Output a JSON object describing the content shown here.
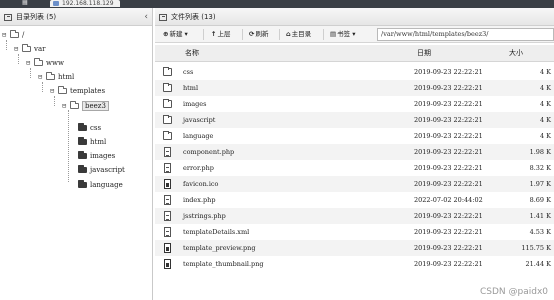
{
  "window": {
    "host": "192.168.118.129"
  },
  "left_panel": {
    "title": "目录列表",
    "count": "(5)",
    "collapse_glyph": "‹",
    "tree": [
      {
        "label": "/",
        "toggle": "⊟"
      },
      {
        "label": "var",
        "toggle": "⊟"
      },
      {
        "label": "www",
        "toggle": "⊟"
      },
      {
        "label": "html",
        "toggle": "⊟"
      },
      {
        "label": "templates",
        "toggle": "⊟"
      },
      {
        "label": "beez3",
        "toggle": "⊟"
      },
      {
        "label": "css",
        "toggle": ""
      },
      {
        "label": "html",
        "toggle": ""
      },
      {
        "label": "images",
        "toggle": ""
      },
      {
        "label": "javascript",
        "toggle": ""
      },
      {
        "label": "language",
        "toggle": ""
      }
    ]
  },
  "right_panel": {
    "title": "文件列表",
    "count": "(13)",
    "toolbar": {
      "new_label": "新建",
      "up_label": "上层",
      "refresh_label": "刷新",
      "home_label": "主目录",
      "bookmark_label": "书签",
      "path_value": "/var/www/html/templates/beez3/"
    },
    "columns": {
      "name": "名称",
      "date": "日期",
      "size": "大小"
    },
    "files": [
      {
        "name": "css",
        "date": "2019-09-23 22:22:21",
        "size": "4 K",
        "kind": "folder"
      },
      {
        "name": "html",
        "date": "2019-09-23 22:22:21",
        "size": "4 K",
        "kind": "folder"
      },
      {
        "name": "images",
        "date": "2019-09-23 22:22:21",
        "size": "4 K",
        "kind": "folder"
      },
      {
        "name": "javascript",
        "date": "2019-09-23 22:22:21",
        "size": "4 K",
        "kind": "folder"
      },
      {
        "name": "language",
        "date": "2019-09-23 22:22:21",
        "size": "4 K",
        "kind": "folder"
      },
      {
        "name": "component.php",
        "date": "2019-09-23 22:22:21",
        "size": "1.98 K",
        "kind": "file"
      },
      {
        "name": "error.php",
        "date": "2019-09-23 22:22:21",
        "size": "8.32 K",
        "kind": "file"
      },
      {
        "name": "favicon.ico",
        "date": "2019-09-23 22:22:21",
        "size": "1.97 K",
        "kind": "image"
      },
      {
        "name": "index.php",
        "date": "2022-07-02 20:44:02",
        "size": "8.69 K",
        "kind": "file"
      },
      {
        "name": "jsstrings.php",
        "date": "2019-09-23 22:22:21",
        "size": "1.41 K",
        "kind": "file"
      },
      {
        "name": "templateDetails.xml",
        "date": "2019-09-23 22:22:21",
        "size": "4.53 K",
        "kind": "file"
      },
      {
        "name": "template_preview.png",
        "date": "2019-09-23 22:22:21",
        "size": "115.75 K",
        "kind": "image"
      },
      {
        "name": "template_thumbnail.png",
        "date": "2019-09-23 22:22:21",
        "size": "21.44 K",
        "kind": "image"
      }
    ]
  },
  "watermark": "CSDN @paidx0"
}
